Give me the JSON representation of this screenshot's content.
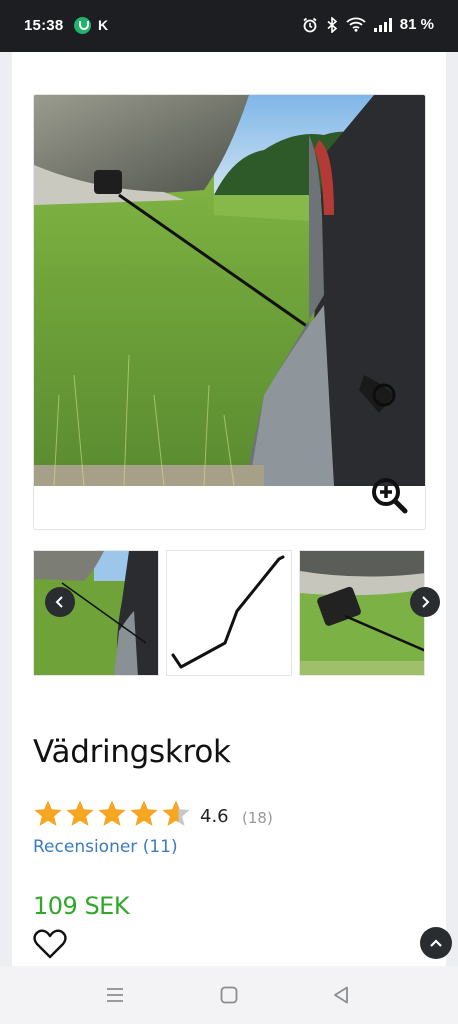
{
  "status_bar": {
    "time": "15:38",
    "carrier_letter": "K",
    "battery": "81 %",
    "icons": [
      "vpn-app-icon",
      "alarm-icon",
      "bluetooth-icon",
      "wifi-icon",
      "signal-icon"
    ]
  },
  "product": {
    "title": "Vädringskrok",
    "rating_value": "4.6",
    "rating_count": "(18)",
    "rating_stars": 4.6,
    "reviews_link": "Recensioner (11)",
    "price": "109 SEK"
  },
  "gallery": {
    "thumbnails": [
      "car-trunk-photo",
      "hook-product-photo",
      "hook-closeup-photo"
    ]
  },
  "colors": {
    "star": "#f5a623",
    "star_empty": "#c8c8c8",
    "price": "#2fa829",
    "link": "#3b7bc0",
    "dark_button": "#2a2d30"
  },
  "nav": [
    "menu-icon",
    "home-icon",
    "back-icon"
  ]
}
